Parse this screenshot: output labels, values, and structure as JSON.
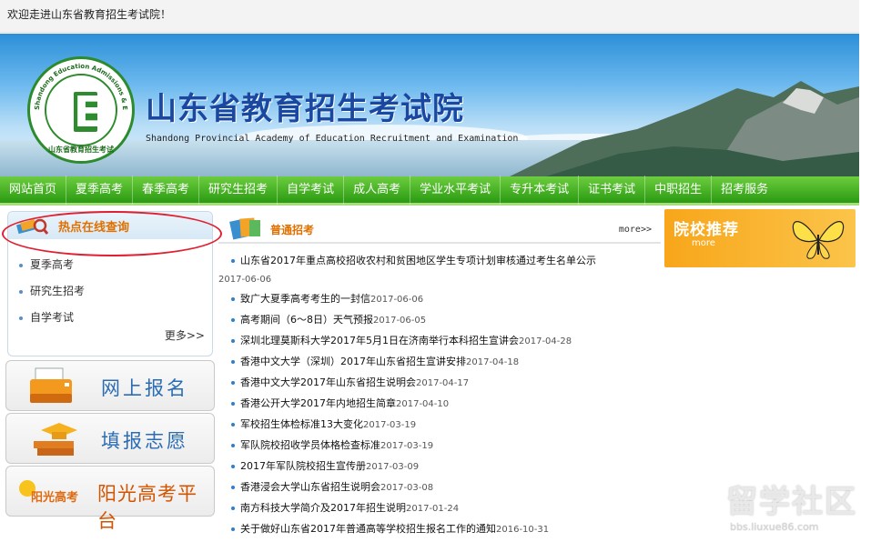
{
  "welcome": "欢迎走进山东省教育招生考试院！",
  "header": {
    "title": "山东省教育招生考试院",
    "subtitle": "Shandong Provincial Academy of Education  Recruitment and Examination",
    "logo_letter": "E",
    "logo_ring_text": "Shandong Education Admissions & Examinations",
    "logo_bottom_text": "山东省教育招生考试"
  },
  "nav": [
    "网站首页",
    "夏季高考",
    "春季高考",
    "研究生招考",
    "自学考试",
    "成人高考",
    "学业水平考试",
    "专升本考试",
    "证书考试",
    "中职招生",
    "招考服务"
  ],
  "sidebar": {
    "query_title": "热点在线查询",
    "query_items": [
      "夏季高考",
      "研究生招考",
      "自学考试"
    ],
    "more": "更多>>",
    "buttons": [
      "网上报名",
      "填报志愿",
      "阳光高考平台"
    ],
    "sunshine_logo": "阳光高考"
  },
  "main": {
    "section_title": "普通招考",
    "more": "more>>",
    "news": [
      {
        "title": "山东省2017年重点高校招收农村和贫困地区学生专项计划审核通过考生名单公示",
        "date": "2017-06-06"
      },
      {
        "title": "致广大夏季高考考生的一封信",
        "date": "2017-06-06"
      },
      {
        "title": "高考期间（6～8日）天气预报",
        "date": "2017-06-05"
      },
      {
        "title": "深圳北理莫斯科大学2017年5月1日在济南举行本科招生宣讲会",
        "date": "2017-04-28"
      },
      {
        "title": "香港中文大学（深圳）2017年山东省招生宣讲安排",
        "date": "2017-04-18"
      },
      {
        "title": "香港中文大学2017年山东省招生说明会",
        "date": "2017-04-17"
      },
      {
        "title": "香港公开大学2017年内地招生简章",
        "date": "2017-04-10"
      },
      {
        "title": "军校招生体检标准13大变化",
        "date": "2017-03-19"
      },
      {
        "title": "军队院校招收学员体格检查标准",
        "date": "2017-03-19"
      },
      {
        "title": "2017年军队院校招生宣传册",
        "date": "2017-03-09"
      },
      {
        "title": "香港浸会大学山东省招生说明会",
        "date": "2017-03-08"
      },
      {
        "title": "南方科技大学简介及2017年招生说明",
        "date": "2017-01-24"
      },
      {
        "title": "关于做好山东省2017年普通高等学校招生报名工作的通知",
        "date": "2016-10-31"
      }
    ]
  },
  "promo": {
    "title": "院校推荐",
    "more": "more"
  },
  "watermark": {
    "text": "留学社区",
    "url": "bbs.liuxue86.com"
  }
}
